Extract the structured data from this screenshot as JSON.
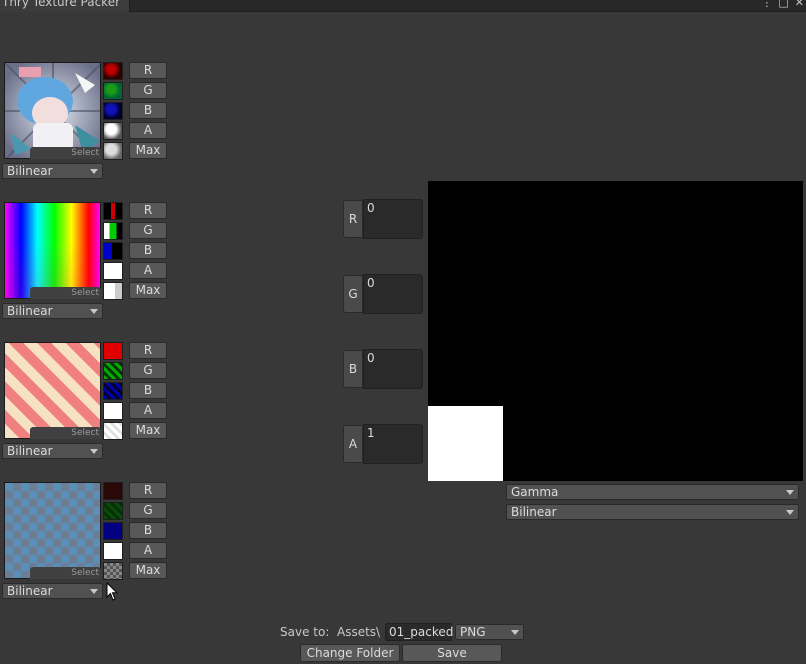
{
  "window": {
    "title": "Thry Texture Packer",
    "controls": [
      "⋮",
      "□",
      "✕"
    ]
  },
  "inputs": [
    {
      "thumb": "character",
      "select_label": "Select",
      "filter": "Bilinear",
      "channel_buttons": [
        "R",
        "G",
        "B",
        "A",
        "Max"
      ],
      "channel_swatches": [
        "red-noise",
        "green-noise",
        "blue-noise",
        "alpha-noise",
        "gray-noise"
      ]
    },
    {
      "thumb": "hue-gradient",
      "select_label": "Select",
      "filter": "Bilinear",
      "channel_buttons": [
        "R",
        "G",
        "B",
        "A",
        "Max"
      ],
      "channel_swatches": [
        "red-split",
        "green-split",
        "blue-split",
        "white",
        "white-fade"
      ]
    },
    {
      "thumb": "stripes",
      "select_label": "Select",
      "filter": "Bilinear",
      "channel_buttons": [
        "R",
        "G",
        "B",
        "A",
        "Max"
      ],
      "channel_swatches": [
        "red",
        "green-stripes",
        "blue-stripes",
        "white",
        "white-stripes"
      ]
    },
    {
      "thumb": "checker",
      "select_label": "Select",
      "filter": "Bilinear",
      "channel_buttons": [
        "R",
        "G",
        "B",
        "A",
        "Max"
      ],
      "channel_swatches": [
        "dark-red",
        "dark-green",
        "navy",
        "white",
        "checker"
      ]
    }
  ],
  "output_values": [
    {
      "channel": "R",
      "value": "0"
    },
    {
      "channel": "G",
      "value": "0"
    },
    {
      "channel": "B",
      "value": "0"
    },
    {
      "channel": "A",
      "value": "1"
    }
  ],
  "preview": {
    "color_space": "Gamma",
    "filter": "Bilinear"
  },
  "save": {
    "label": "Save to:",
    "folder": "Assets\\",
    "filename": "01_packed",
    "format": "PNG",
    "change_folder_label": "Change Folder",
    "save_label": "Save"
  }
}
